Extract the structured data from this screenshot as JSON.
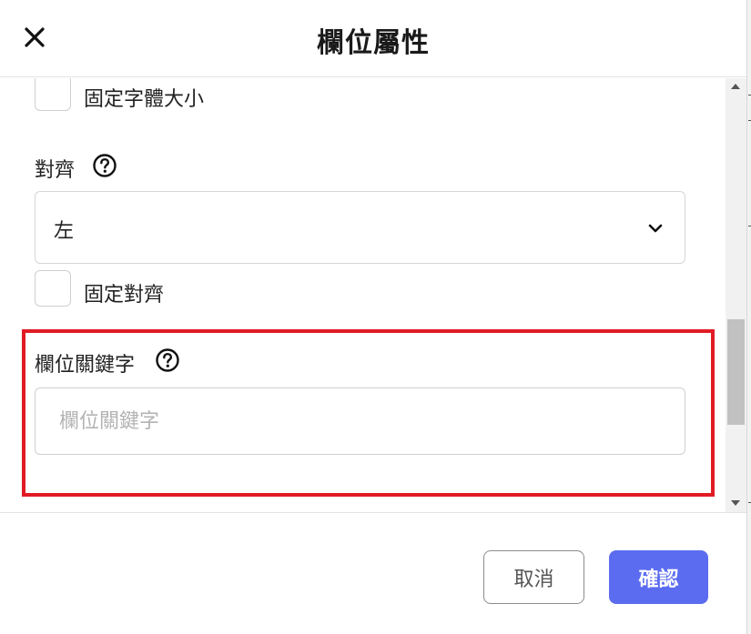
{
  "dialog": {
    "title": "欄位屬性",
    "accent_color": "#5b6cf0",
    "highlight_color": "#e01b24"
  },
  "fields": {
    "fixed_font_size": {
      "label": "固定字體大小",
      "checked": false
    },
    "alignment": {
      "label": "對齊",
      "help_icon": "question-circle-icon",
      "selected": "左"
    },
    "fixed_alignment": {
      "label": "固定對齊",
      "checked": false
    },
    "field_keyword": {
      "label": "欄位關鍵字",
      "help_icon": "question-circle-icon",
      "value": "",
      "placeholder": "欄位關鍵字"
    }
  },
  "footer": {
    "cancel_label": "取消",
    "confirm_label": "確認"
  }
}
